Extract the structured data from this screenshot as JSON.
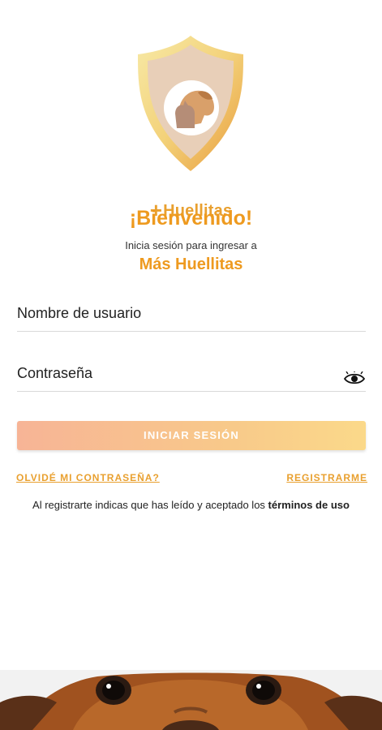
{
  "brand": {
    "logo_text": "Huellitas",
    "logo_plus": "+"
  },
  "welcome": {
    "title": "¡Bienvenido!",
    "subtitle": "Inicia sesión para ingresar a",
    "app_name": "Más Huellitas"
  },
  "form": {
    "username_label": "Nombre de usuario",
    "password_label": "Contraseña",
    "password_toggle_icon": "eye-icon",
    "login_button": "INICIAR SESIÓN"
  },
  "links": {
    "forgot_password": "OLVIDÉ MI CONTRASEÑA?",
    "register": "REGISTRARME"
  },
  "terms": {
    "prefix": "Al registrarte indicas que has leído y aceptado los ",
    "link": "términos de uso"
  },
  "colors": {
    "accent": "#ee9a1f",
    "button_gradient_start": "#f7b496",
    "button_gradient_end": "#fbd98a"
  }
}
